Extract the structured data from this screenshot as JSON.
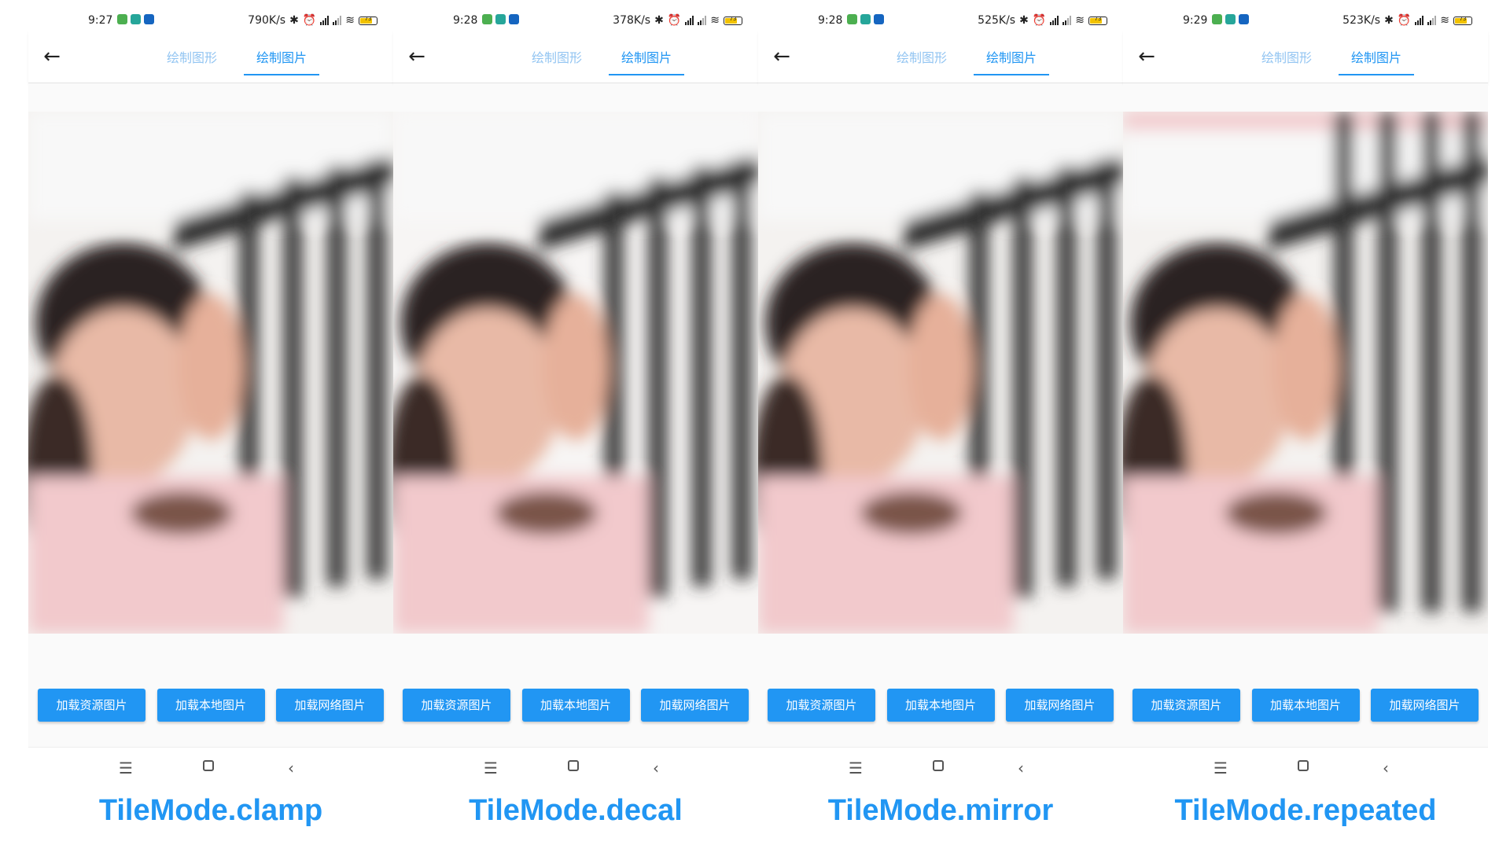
{
  "colors": {
    "accent": "#2196f3",
    "tab_inactive": "#93c5f2",
    "background": "#fafafa"
  },
  "panels": [
    {
      "time": "9:27",
      "net_speed": "790K/s",
      "battery": "73",
      "tabs": [
        "绘制图形",
        "绘制图片"
      ],
      "active_tab": 1,
      "buttons": [
        "加载资源图片",
        "加载本地图片",
        "加载网络图片"
      ],
      "caption": "TileMode.clamp"
    },
    {
      "time": "9:28",
      "net_speed": "378K/s",
      "battery": "73",
      "tabs": [
        "绘制图形",
        "绘制图片"
      ],
      "active_tab": 1,
      "buttons": [
        "加载资源图片",
        "加载本地图片",
        "加载网络图片"
      ],
      "caption": "TileMode.decal"
    },
    {
      "time": "9:28",
      "net_speed": "525K/s",
      "battery": "73",
      "tabs": [
        "绘制图形",
        "绘制图片"
      ],
      "active_tab": 1,
      "buttons": [
        "加载资源图片",
        "加载本地图片",
        "加载网络图片"
      ],
      "caption": "TileMode.mirror"
    },
    {
      "time": "9:29",
      "net_speed": "523K/s",
      "battery": "73",
      "tabs": [
        "绘制图形",
        "绘制图片"
      ],
      "active_tab": 1,
      "buttons": [
        "加载资源图片",
        "加载本地图片",
        "加载网络图片"
      ],
      "caption": "TileMode.repeated"
    }
  ],
  "icons": {
    "back": "arrow-left-icon",
    "status_apps": [
      "app-green-icon",
      "app-teal-icon",
      "app-blue-icon"
    ],
    "status_right": [
      "bluetooth-icon",
      "alarm-icon",
      "signal-icon",
      "signal-icon",
      "wifi-icon",
      "battery-icon"
    ],
    "nav": [
      "menu-icon",
      "home-icon",
      "back-icon"
    ]
  }
}
